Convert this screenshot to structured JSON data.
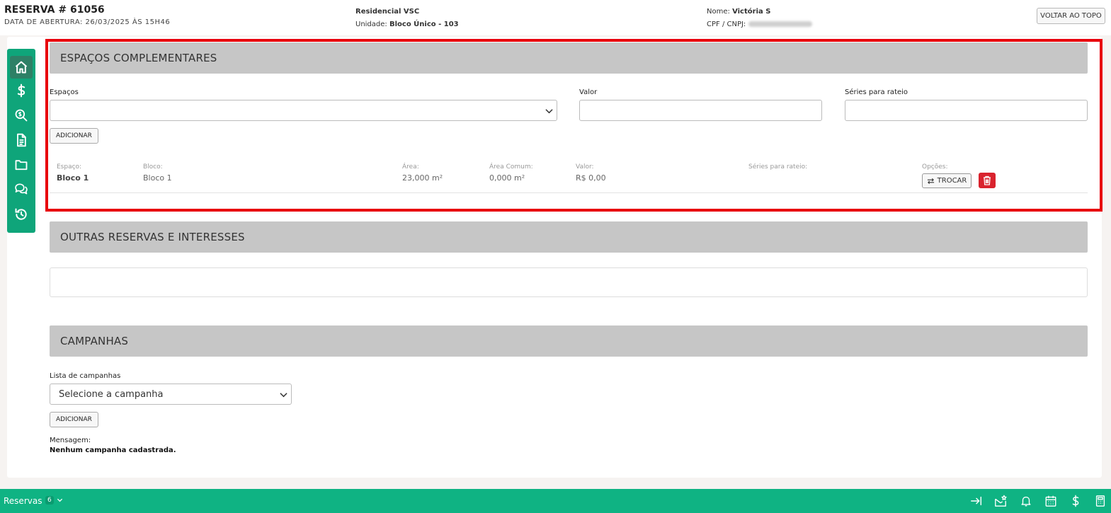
{
  "header": {
    "title": "RESERVA # 61056",
    "opening_date": "DATA DE ABERTURA: 26/03/2025 ÀS 15H46",
    "project": "Residencial VSC",
    "unit_label": "Unidade:",
    "unit_value": "Bloco Único - 103",
    "name_label": "Nome:",
    "name_value": "Victória S",
    "cpf_label": "CPF / CNPJ:",
    "back_top_label": "VOLTAR AO TOPO"
  },
  "sidebar": {
    "items": [
      {
        "icon": "home-icon",
        "active": true
      },
      {
        "icon": "dollar-icon",
        "active": false
      },
      {
        "icon": "search-money-icon",
        "active": false
      },
      {
        "icon": "document-icon",
        "active": false
      },
      {
        "icon": "folder-icon",
        "active": false
      },
      {
        "icon": "chat-icon",
        "active": false
      },
      {
        "icon": "history-icon",
        "active": false
      }
    ]
  },
  "espacos": {
    "title": "ESPAÇOS COMPLEMENTARES",
    "espacos_label": "Espaços",
    "espacos_value": "",
    "valor_label": "Valor",
    "valor_value": "",
    "series_label": "Séries para rateio",
    "series_value": "",
    "add_label": "ADICIONAR",
    "table": {
      "headers": {
        "espaco": "Espaço:",
        "bloco": "Bloco:",
        "area": "Área:",
        "area_comum": "Área Comum:",
        "valor": "Valor:",
        "series": "Séries para rateio:",
        "opcoes": "Opções:"
      },
      "row": {
        "espaco": "Bloco 1",
        "bloco": "Bloco 1",
        "area": "23,000 m²",
        "area_comum": "0,000 m²",
        "valor": "R$ 0,00",
        "series": ""
      },
      "swap_label": "TROCAR"
    }
  },
  "outras": {
    "title": "OUTRAS RESERVAS E INTERESSES"
  },
  "campanhas": {
    "title": "CAMPANHAS",
    "list_label": "Lista de campanhas",
    "select_value": "Selecione a campanha",
    "add_label": "ADICIONAR",
    "message_label": "Mensagem:",
    "message_value": "Nenhum campanha cadastrada."
  },
  "bottombar": {
    "label": "Reservas",
    "count": "6",
    "icons": [
      "collapse-right-icon",
      "mail-star-icon",
      "bell-icon",
      "calendar-icon",
      "dollar-icon",
      "calculator-icon"
    ]
  },
  "colors": {
    "accent_green": "#0fb383",
    "sidebar_green": "#0fa57a",
    "highlight_red": "#e8000b",
    "delete_red": "#d9232e"
  }
}
